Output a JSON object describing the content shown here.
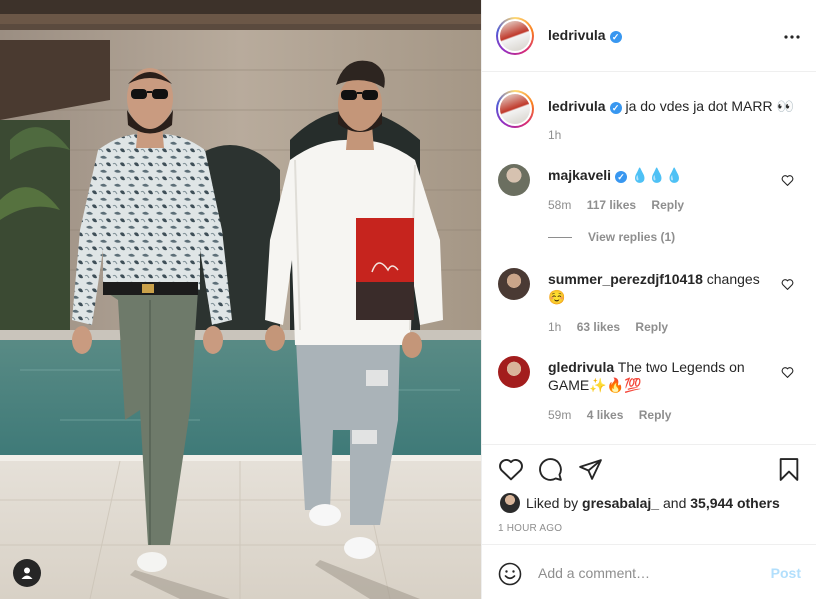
{
  "post": {
    "username": "ledrivula",
    "verified": true,
    "more_icon": "more-horizontal-icon",
    "caption": {
      "username": "ledrivula",
      "text": "ja do vdes ja dot MARR 👀",
      "time": "1h"
    },
    "comments": [
      {
        "username": "majkaveli",
        "verified": true,
        "text": "💧💧💧",
        "time": "58m",
        "likes": "117 likes",
        "reply": "Reply",
        "view_replies": "View replies (1)"
      },
      {
        "username": "summer_perezdjf10418",
        "text": "changes ☺️",
        "time": "1h",
        "likes": "63 likes",
        "reply": "Reply"
      },
      {
        "username": "gledrivula",
        "text": "The two Legends on GAME✨🔥💯",
        "time": "59m",
        "likes": "4 likes",
        "reply": "Reply"
      }
    ],
    "likes": {
      "prefix": "Liked by",
      "user": "gresabalaj_",
      "middle": "and",
      "count": "35,944 others"
    },
    "timestamp": "1 HOUR AGO",
    "add_comment": {
      "placeholder": "Add a comment…",
      "post_label": "Post"
    }
  },
  "icons": {
    "like": "heart-icon",
    "comment": "comment-icon",
    "share": "paper-plane-icon",
    "save": "bookmark-icon",
    "emoji": "smiley-icon",
    "user_tag": "user-tag-icon"
  },
  "colors": {
    "verified": "#3897f0",
    "post_disabled": "#b2dffc",
    "meta_text": "#8e8e8e",
    "border": "#efefef"
  }
}
